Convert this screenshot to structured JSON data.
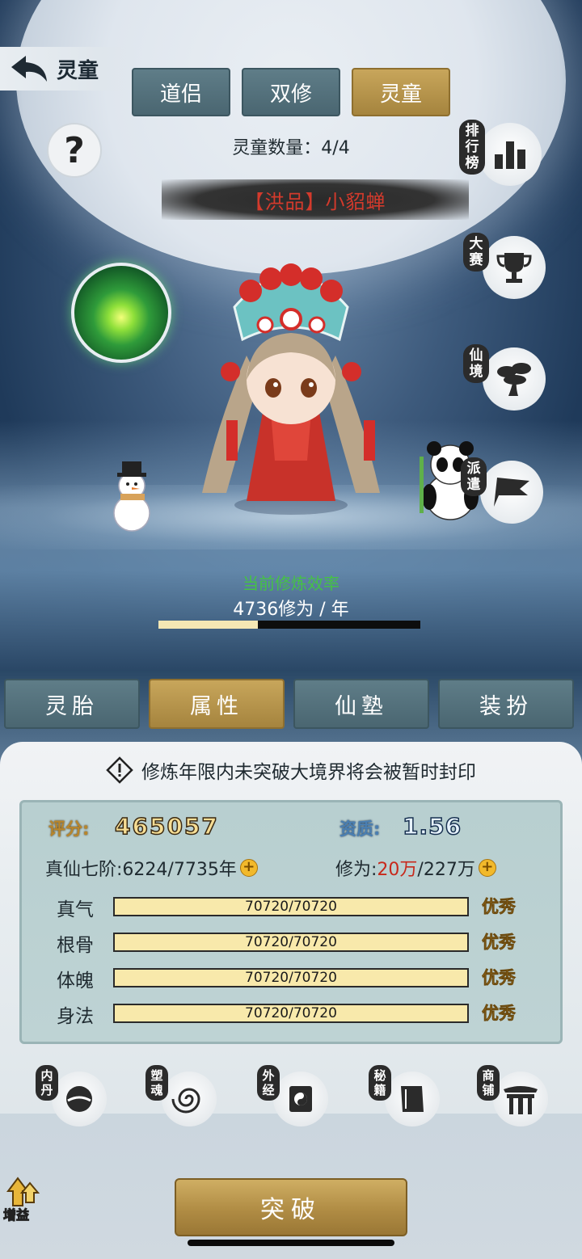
{
  "header": {
    "back_label": "灵童"
  },
  "top_tabs": [
    {
      "label": "道侣",
      "active": false
    },
    {
      "label": "双修",
      "active": false
    },
    {
      "label": "灵童",
      "active": true
    }
  ],
  "count": {
    "label": "灵童数量：4/4"
  },
  "character": {
    "name": "【洪品】小貂蝉"
  },
  "side_buttons": [
    {
      "label": "排行榜",
      "icon": "ranking-icon"
    },
    {
      "label": "大赛",
      "icon": "trophy-icon"
    },
    {
      "label": "仙境",
      "icon": "tree-icon"
    },
    {
      "label": "派遣",
      "icon": "flag-icon"
    }
  ],
  "efficiency": {
    "label": "当前修炼效率",
    "value": "4736修为 / 年",
    "progress": 0.38
  },
  "sub_tabs": [
    {
      "label": "灵胎",
      "active": false
    },
    {
      "label": "属性",
      "active": true
    },
    {
      "label": "仙塾",
      "active": false
    },
    {
      "label": "装扮",
      "active": false
    }
  ],
  "warning": "修炼年限内未突破大境界将会被暂时封印",
  "stats": {
    "score_label": "评分:",
    "score_value": "465057",
    "talent_label": "资质:",
    "talent_value": "1.56",
    "realm_label": "真仙七阶:",
    "realm_value": "6224/7735年",
    "cultivation_label": "修为:",
    "cultivation_current": "20万",
    "cultivation_total": "/227万"
  },
  "attributes": [
    {
      "name": "真气",
      "value": "70720/70720",
      "fill": 1.0,
      "grade": "优秀"
    },
    {
      "name": "根骨",
      "value": "70720/70720",
      "fill": 1.0,
      "grade": "优秀"
    },
    {
      "name": "体魄",
      "value": "70720/70720",
      "fill": 1.0,
      "grade": "优秀"
    },
    {
      "name": "身法",
      "value": "70720/70720",
      "fill": 1.0,
      "grade": "优秀"
    }
  ],
  "features": [
    {
      "label": "内丹",
      "icon": "inner-core-icon"
    },
    {
      "label": "塑魂",
      "icon": "soul-swirl-icon"
    },
    {
      "label": "外经",
      "icon": "scroll-icon"
    },
    {
      "label": "秘籍",
      "icon": "book-icon"
    },
    {
      "label": "商铺",
      "icon": "shop-gate-icon"
    }
  ],
  "buff_label": "增益",
  "breakthrough_label": "突破"
}
